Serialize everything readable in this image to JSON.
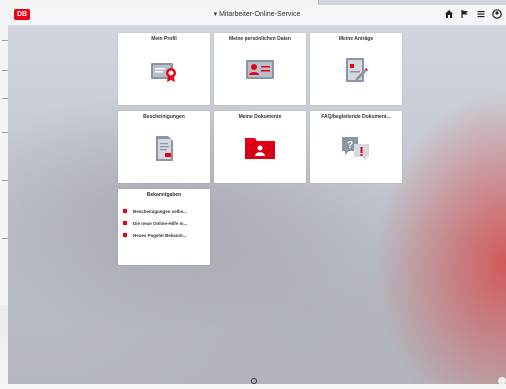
{
  "header": {
    "logo_text": "DB",
    "title": "▾ Mitarbeiter-Online-Service",
    "icons": [
      "home-icon",
      "flag-icon",
      "menu-icon",
      "user-icon"
    ]
  },
  "tiles": [
    {
      "title": "Mein Profil",
      "icon": "certificate-icon"
    },
    {
      "title": "Meine persönlichen Daten",
      "icon": "id-card-icon"
    },
    {
      "title": "Meine Anträge",
      "icon": "form-edit-icon"
    },
    {
      "title": "Bescheinigungen",
      "icon": "document-icon"
    },
    {
      "title": "Meine Dokumente",
      "icon": "folder-person-icon"
    },
    {
      "title": "FAQ/begleitende Dokument...",
      "icon": "faq-icon"
    }
  ],
  "news": {
    "title": "Bekanntgaben",
    "items": [
      "Bescheinigungen selbs...",
      "Die neue Online-Hilfe m...",
      "Neues Pagelet Bekannt..."
    ]
  },
  "colors": {
    "accent": "#ec0016",
    "text": "#333333"
  }
}
